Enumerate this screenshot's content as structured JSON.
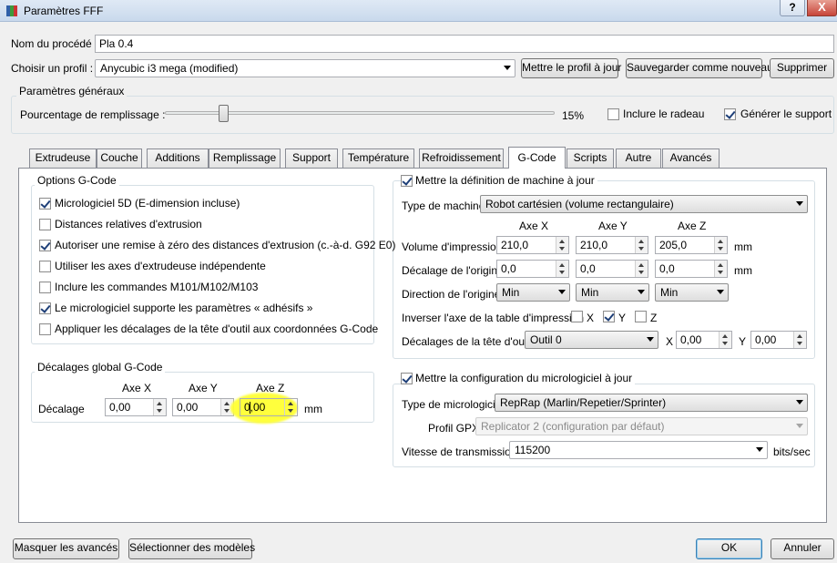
{
  "window": {
    "title": "Paramètres FFF",
    "help": "?",
    "close": "X"
  },
  "procedure": {
    "label": "Nom du procédé :",
    "value": "Pla 0.4"
  },
  "profile": {
    "label": "Choisir un profil :",
    "selected": "Anycubic i3 mega (modified)",
    "update_btn": "Mettre le profil à jour",
    "save_btn": "Sauvegarder comme nouveau",
    "delete_btn": "Supprimer"
  },
  "general": {
    "title": "Paramètres généraux",
    "fill_label": "Pourcentage de remplissage :",
    "fill_value": "15%",
    "fill_fraction": 0.15,
    "raft_label": "Inclure le radeau",
    "raft_checked": false,
    "support_label": "Générer le support",
    "support_checked": true
  },
  "tabs": [
    {
      "label": "Extrudeuse"
    },
    {
      "label": "Couche"
    },
    {
      "label": "Additions"
    },
    {
      "label": "Remplissage"
    },
    {
      "label": "Support"
    },
    {
      "label": "Température"
    },
    {
      "label": "Refroidissement"
    },
    {
      "label": "G-Code",
      "active": true
    },
    {
      "label": "Scripts"
    },
    {
      "label": "Autre"
    },
    {
      "label": "Avancés"
    }
  ],
  "gcode_options": {
    "title": "Options G-Code",
    "items": [
      {
        "label": "Micrologiciel 5D (E-dimension incluse)",
        "checked": true
      },
      {
        "label": "Distances relatives d'extrusion",
        "checked": false
      },
      {
        "label": "Autoriser une remise à zéro des distances d'extrusion (c.-à-d. G92 E0)",
        "checked": true
      },
      {
        "label": "Utiliser les axes d'extrudeuse indépendente",
        "checked": false
      },
      {
        "label": "Inclure les commandes M101/M102/M103",
        "checked": false
      },
      {
        "label": "Le micrologiciel supporte les paramètres « adhésifs »",
        "checked": true
      },
      {
        "label": "Appliquer les décalages de la tête d'outil aux coordonnées G-Code",
        "checked": false
      }
    ]
  },
  "global_offsets": {
    "title": "Décalages global G-Code",
    "axis_x": "Axe X",
    "axis_y": "Axe Y",
    "axis_z": "Axe Z",
    "row_label": "Décalage",
    "x": "0,00",
    "y": "0,00",
    "z": "0,00",
    "unit": "mm"
  },
  "machine": {
    "title": "Mettre la définition de machine à jour",
    "checked": true,
    "type_label": "Type de machine",
    "type_value": "Robot cartésien (volume rectangulaire)",
    "axis_x": "Axe X",
    "axis_y": "Axe Y",
    "axis_z": "Axe Z",
    "volume_label": "Volume d'impression",
    "volume": [
      "210,0",
      "210,0",
      "205,0"
    ],
    "origin_label": "Décalage de l'origine",
    "origin": [
      "0,0",
      "0,0",
      "0,0"
    ],
    "unit": "mm",
    "direction_label": "Direction de l'origine",
    "direction": [
      "Min",
      "Min",
      "Min"
    ],
    "invert_label": "Inverser l'axe de la table d'impression",
    "invert": [
      {
        "label": "X",
        "checked": false
      },
      {
        "label": "Y",
        "checked": true
      },
      {
        "label": "Z",
        "checked": false
      }
    ],
    "tool_offset_label": "Décalages de la tête d'outil",
    "tool_value": "Outil 0",
    "x_label": "X",
    "x_value": "0,00",
    "y_label": "Y",
    "y_value": "0,00"
  },
  "firmware": {
    "title": "Mettre la configuration du micrologiciel à jour",
    "checked": true,
    "type_label": "Type de micrologiciel",
    "type_value": "RepRap (Marlin/Repetier/Sprinter)",
    "gpx_label": "Profil GPX",
    "gpx_value": "Replicator 2 (configuration par défaut)",
    "baud_label": "Vitesse de transmission",
    "baud_value": "115200",
    "baud_unit": "bits/sec"
  },
  "footer": {
    "hide_advanced": "Masquer les avancés",
    "select_models": "Sélectionner des modèles",
    "ok": "OK",
    "cancel": "Annuler"
  },
  "colors": {
    "highlight": "#ffff33",
    "titlebar": "#c9d9ec"
  }
}
